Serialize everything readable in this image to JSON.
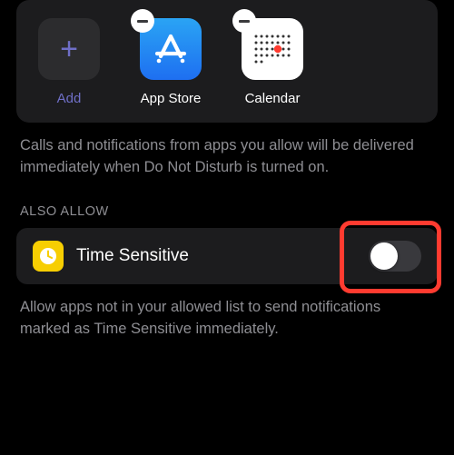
{
  "apps": {
    "add_label": "Add",
    "items": [
      {
        "label": "App Store"
      },
      {
        "label": "Calendar"
      }
    ]
  },
  "allowed_desc": "Calls and notifications from apps you allow will be delivered immediately when Do Not Disturb is turned on.",
  "also_allow_header": "ALSO ALLOW",
  "time_sensitive": {
    "title": "Time Sensitive",
    "desc": "Allow apps not in your allowed list to send notifications marked as Time Sensitive immediately.",
    "enabled": false
  },
  "colors": {
    "accent_purple": "#6f6fc7",
    "highlight": "#ff3b30",
    "card_bg": "#1c1c1e"
  }
}
